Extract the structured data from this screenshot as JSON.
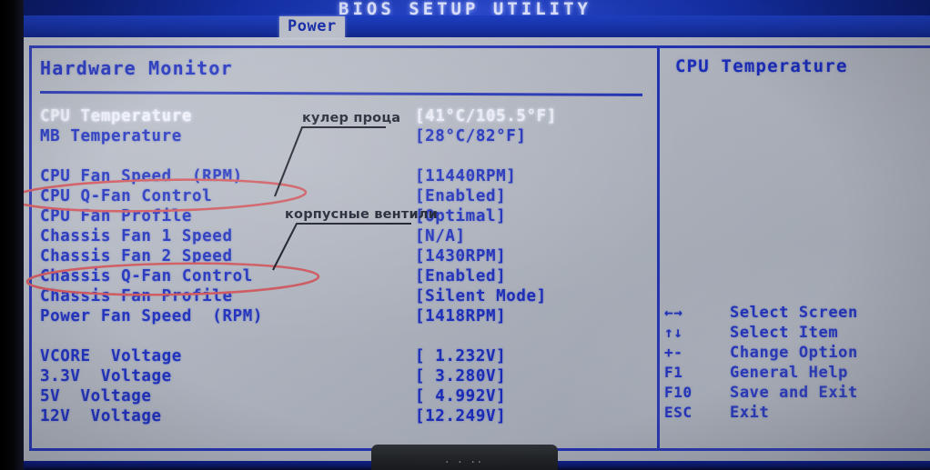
{
  "header": {
    "title": "BIOS SETUP UTILITY",
    "active_tab": "Power"
  },
  "left_panel": {
    "section_title": "Hardware Monitor",
    "rows": [
      {
        "label": "CPU Temperature",
        "value": "[41°C/105.5°F]",
        "highlighted": true
      },
      {
        "label": "MB Temperature",
        "value": "[28°C/82°F]",
        "highlighted": false
      },
      {
        "label": "",
        "value": "",
        "highlighted": false
      },
      {
        "label": "CPU Fan Speed  (RPM)",
        "value": "[11440RPM]",
        "highlighted": false
      },
      {
        "label": "CPU Q-Fan Control",
        "value": "[Enabled]",
        "highlighted": false
      },
      {
        "label": "CPU Fan Profile",
        "value": "[Optimal]",
        "highlighted": false
      },
      {
        "label": "Chassis Fan 1 Speed",
        "value": "[N/A]",
        "highlighted": false
      },
      {
        "label": "Chassis Fan 2 Speed",
        "value": "[1430RPM]",
        "highlighted": false
      },
      {
        "label": "Chassis Q-Fan Control",
        "value": "[Enabled]",
        "highlighted": false
      },
      {
        "label": "Chassis Fan Profile",
        "value": "[Silent Mode]",
        "highlighted": false
      },
      {
        "label": "Power Fan Speed  (RPM)",
        "value": "[1418RPM]",
        "highlighted": false
      },
      {
        "label": "",
        "value": "",
        "highlighted": false
      },
      {
        "label": "VCORE  Voltage",
        "value": "[ 1.232V]",
        "highlighted": false
      },
      {
        "label": "3.3V  Voltage",
        "value": "[ 3.280V]",
        "highlighted": false
      },
      {
        "label": "5V  Voltage",
        "value": "[ 4.992V]",
        "highlighted": false
      },
      {
        "label": "12V  Voltage",
        "value": "[12.249V]",
        "highlighted": false
      }
    ]
  },
  "right_panel": {
    "help_title": "CPU Temperature",
    "legend": [
      {
        "key": "←→",
        "action": "Select Screen"
      },
      {
        "key": "↑↓",
        "action": "Select Item"
      },
      {
        "key": "+-",
        "action": "Change Option"
      },
      {
        "key": "F1",
        "action": "General Help"
      },
      {
        "key": "F10",
        "action": "Save and Exit"
      },
      {
        "key": "ESC",
        "action": "Exit"
      }
    ]
  },
  "annotations": {
    "note_cpu_fan": "кулер проца",
    "note_case_fans": "корпусные вентили",
    "circled_items": [
      "CPU Q-Fan Control",
      "Chassis Q-Fan Control"
    ],
    "ink_color": "#d1555c"
  },
  "artifact": {
    "dots": "· · ··"
  },
  "colors": {
    "text_blue": "#1c2ec0",
    "text_white": "#f2f4ff",
    "panel_grey": "#b4b9c4",
    "chrome_blue": "#1935ab",
    "frame_blue": "#2434b8"
  }
}
